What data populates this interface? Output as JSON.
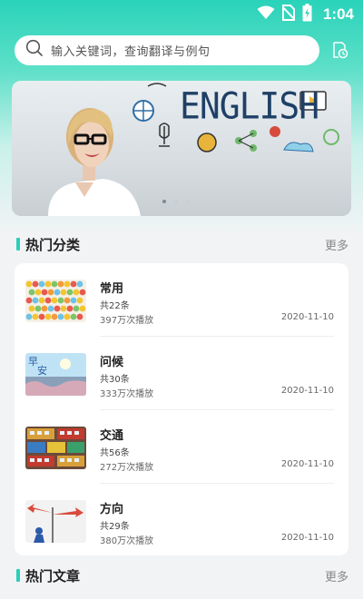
{
  "status_bar": {
    "time": "1:04"
  },
  "search": {
    "placeholder": "输入关键词，查询翻译与例句"
  },
  "banner": {
    "word": "ENGLISH",
    "slides": 3,
    "active_slide": 1
  },
  "hot_categories": {
    "title": "热门分类",
    "more_label": "更多",
    "items": [
      {
        "title": "常用",
        "count": "共22条",
        "plays": "397万次播放",
        "date": "2020-11-10",
        "thumb_icon": "smiley-grid-thumbnail"
      },
      {
        "title": "问候",
        "count": "共30条",
        "plays": "333万次播放",
        "date": "2020-11-10",
        "thumb_icon": "good-morning-thumbnail"
      },
      {
        "title": "交通",
        "count": "共56条",
        "plays": "272万次播放",
        "date": "2020-11-10",
        "thumb_icon": "buses-thumbnail"
      },
      {
        "title": "方向",
        "count": "共29条",
        "plays": "380万次播放",
        "date": "2020-11-10",
        "thumb_icon": "signpost-thumbnail"
      }
    ]
  },
  "hot_articles": {
    "title": "热门文章",
    "more_label": "更多"
  },
  "colors": {
    "accent": "#2ccfb8",
    "header_top": "#29d3b9"
  }
}
